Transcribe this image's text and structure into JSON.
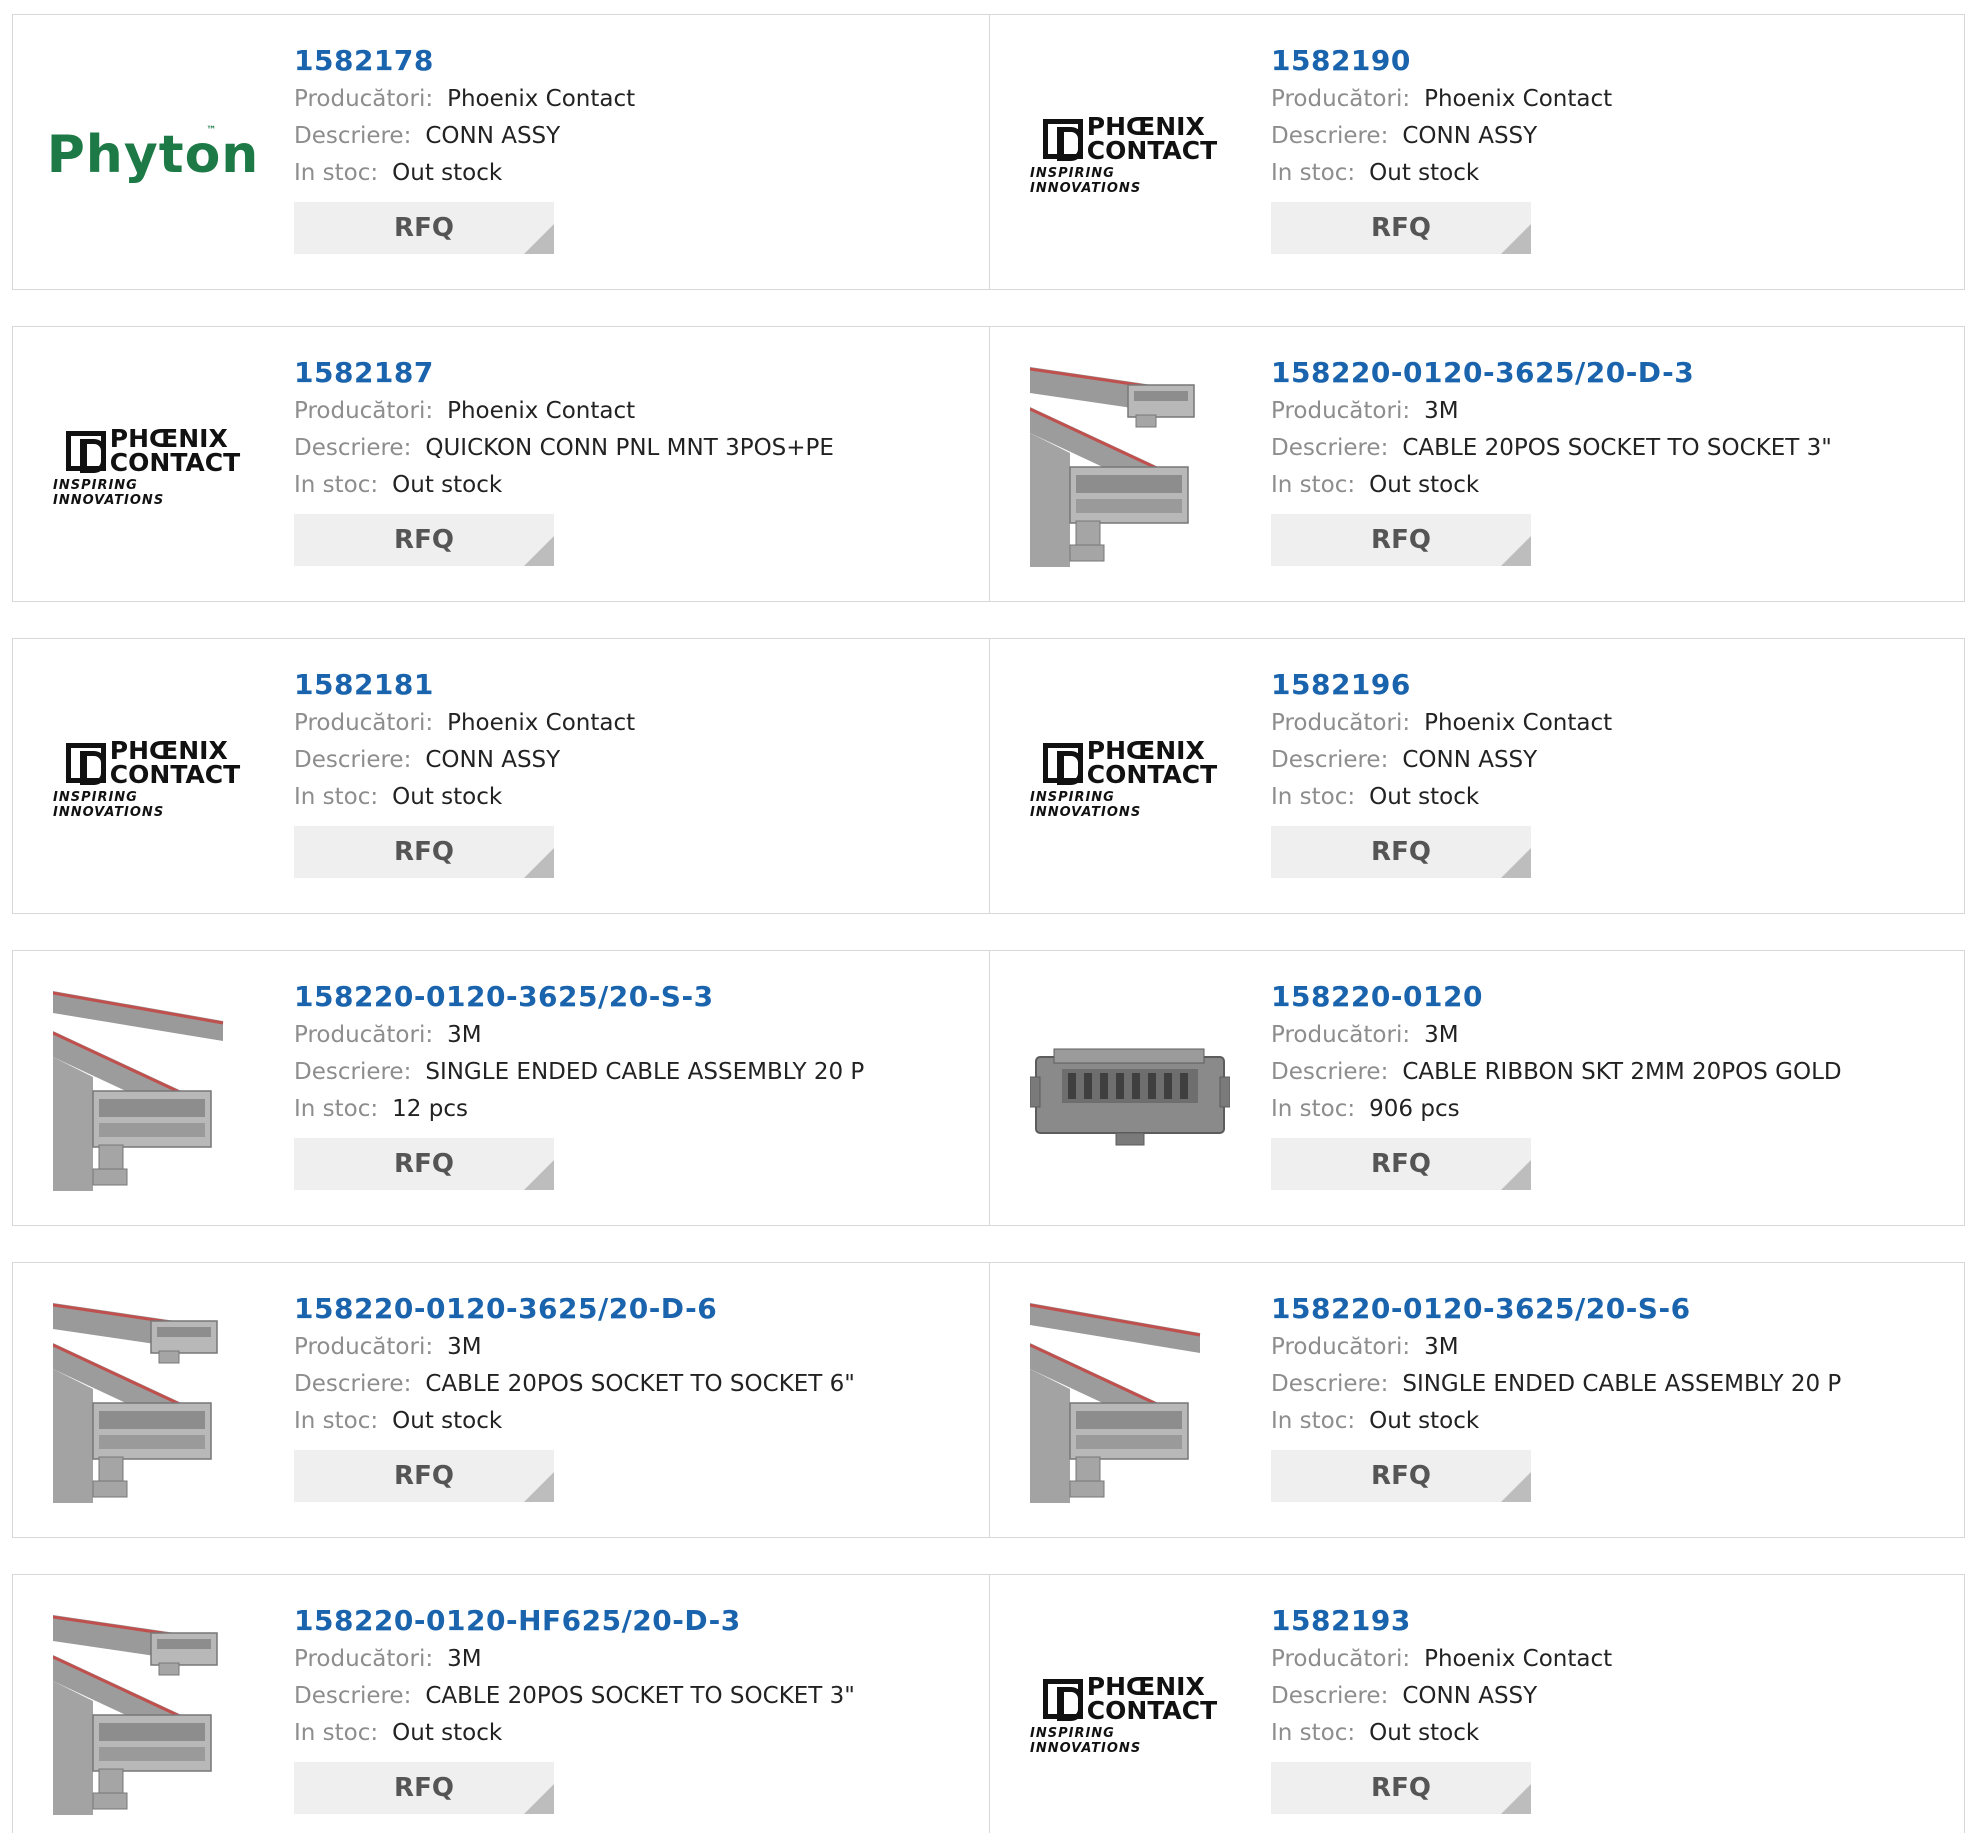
{
  "labels": {
    "manufacturer": "Producători:",
    "description": "Descriere:",
    "stock": "In stoc:",
    "rfq": "RFQ"
  },
  "logos": {
    "phyton": "Phyton",
    "phyton_tm": "™",
    "phoenix_word1": "PHŒNIX",
    "phoenix_word2": "CONTACT",
    "phoenix_tagline": "INSPIRING INNOVATIONS"
  },
  "products": [
    {
      "part_number": "1582178",
      "manufacturer": "Phoenix Contact",
      "description": "CONN ASSY",
      "stock": "Out stock",
      "image": "phyton-logo"
    },
    {
      "part_number": "1582190",
      "manufacturer": "Phoenix Contact",
      "description": "CONN ASSY",
      "stock": "Out stock",
      "image": "phoenix-contact-logo"
    },
    {
      "part_number": "1582187",
      "manufacturer": "Phoenix Contact",
      "description": "QUICKON CONN PNL MNT 3POS+PE",
      "stock": "Out stock",
      "image": "phoenix-contact-logo"
    },
    {
      "part_number": "158220-0120-3625/20-D-3",
      "manufacturer": "3M",
      "description": "CABLE 20POS SOCKET TO SOCKET 3\"",
      "stock": "Out stock",
      "image": "ribbon-cable-double"
    },
    {
      "part_number": "1582181",
      "manufacturer": "Phoenix Contact",
      "description": "CONN ASSY",
      "stock": "Out stock",
      "image": "phoenix-contact-logo"
    },
    {
      "part_number": "1582196",
      "manufacturer": "Phoenix Contact",
      "description": "CONN ASSY",
      "stock": "Out stock",
      "image": "phoenix-contact-logo"
    },
    {
      "part_number": "158220-0120-3625/20-S-3",
      "manufacturer": "3M",
      "description": "SINGLE ENDED CABLE ASSEMBLY 20 P",
      "stock": "12 pcs",
      "image": "ribbon-cable-single"
    },
    {
      "part_number": "158220-0120",
      "manufacturer": "3M",
      "description": "CABLE RIBBON SKT 2MM 20POS GOLD",
      "stock": "906 pcs",
      "image": "socket-connector"
    },
    {
      "part_number": "158220-0120-3625/20-D-6",
      "manufacturer": "3M",
      "description": "CABLE 20POS SOCKET TO SOCKET 6\"",
      "stock": "Out stock",
      "image": "ribbon-cable-double"
    },
    {
      "part_number": "158220-0120-3625/20-S-6",
      "manufacturer": "3M",
      "description": "SINGLE ENDED CABLE ASSEMBLY 20 P",
      "stock": "Out stock",
      "image": "ribbon-cable-single"
    },
    {
      "part_number": "158220-0120-HF625/20-D-3",
      "manufacturer": "3M",
      "description": "CABLE 20POS SOCKET TO SOCKET 3\"",
      "stock": "Out stock",
      "image": "ribbon-cable-double"
    },
    {
      "part_number": "1582193",
      "manufacturer": "Phoenix Contact",
      "description": "CONN ASSY",
      "stock": "Out stock",
      "image": "phoenix-contact-logo"
    }
  ],
  "colors": {
    "part_number": "#1a63ad",
    "label": "#8d8d8d",
    "phyton_green": "#1d7a46",
    "rfq_bg": "#efefef",
    "border": "#d8d8d8"
  }
}
